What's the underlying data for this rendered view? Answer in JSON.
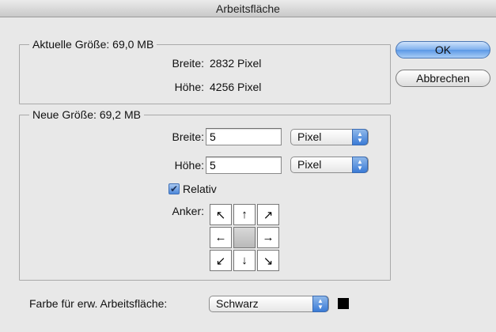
{
  "dialog": {
    "title": "Arbeitsfläche"
  },
  "current": {
    "title": "Aktuelle Größe: 69,0 MB",
    "width_label": "Breite:",
    "width_value": "2832 Pixel",
    "height_label": "Höhe:",
    "height_value": "4256 Pixel"
  },
  "new_size": {
    "title": "Neue Größe: 69,2 MB",
    "width_label": "Breite:",
    "width_value": "5",
    "width_unit": "Pixel",
    "height_label": "Höhe:",
    "height_value": "5",
    "height_unit": "Pixel",
    "relative_label": "Relativ",
    "relative_checked": true,
    "anchor_label": "Anker:",
    "anchor_icons": [
      "arrow-up-left-icon",
      "arrow-up-icon",
      "arrow-up-right-icon",
      "arrow-left-icon",
      "anchor-center",
      "arrow-right-icon",
      "arrow-down-left-icon",
      "arrow-down-icon",
      "arrow-down-right-icon"
    ]
  },
  "extension": {
    "label": "Farbe für erw. Arbeitsfläche:",
    "value": "Schwarz",
    "swatch_color": "#000000"
  },
  "buttons": {
    "ok": "OK",
    "cancel": "Abbrechen"
  },
  "colors": {
    "accent": "#5b98e6"
  }
}
